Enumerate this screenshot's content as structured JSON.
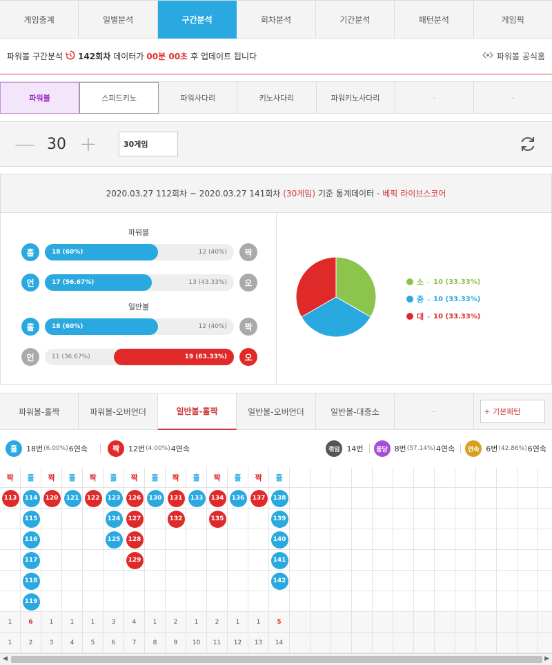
{
  "main_tabs": [
    "게임중계",
    "일별분석",
    "구간분석",
    "회차분석",
    "기간분석",
    "패턴분석",
    "게임픽"
  ],
  "main_active": 2,
  "info": {
    "prefix": "파워볼 구간분석",
    "round": "142회차",
    "mid": "데이터가",
    "time": "00분 00초",
    "suffix": "후 업데이트 됩니다",
    "official": "파워볼 공식홈"
  },
  "game_tabs": [
    "파워볼",
    "스피드키노",
    "파워사다리",
    "키노사다리",
    "파워키노사다리",
    "-",
    "-"
  ],
  "counter": {
    "value": "30",
    "select_label": "30게임"
  },
  "stats_header": {
    "period": "2020.03.27 112회차 ~ 2020.03.27 141회차",
    "games": "(30게임)",
    "mid": "기준 통계데이터 -",
    "source": "베픽 라이브스코어"
  },
  "powerball": {
    "title": "파워볼",
    "rows": [
      {
        "left_label": "홀",
        "right_label": "짝",
        "left_text": "18 (60%)",
        "right_text": "12 (40%)",
        "left_value": 0.6,
        "winner": "left"
      },
      {
        "left_label": "언",
        "right_label": "오",
        "left_text": "17 (56.67%)",
        "right_text": "13 (43.33%)",
        "left_value": 0.5667,
        "winner": "left"
      }
    ]
  },
  "normalball": {
    "title": "일반볼",
    "rows": [
      {
        "left_label": "홀",
        "right_label": "짝",
        "left_text": "18 (60%)",
        "right_text": "12 (40%)",
        "left_value": 0.6,
        "winner": "left"
      },
      {
        "left_label": "언",
        "right_label": "오",
        "left_text": "11 (36.67%)",
        "right_text": "19 (63.33%)",
        "left_value": 0.3667,
        "winner": "right"
      }
    ]
  },
  "pie": {
    "slices": [
      {
        "label": "소",
        "value": 10,
        "text": "10 (33.33%)",
        "color": "#8dc44e"
      },
      {
        "label": "중",
        "value": 10,
        "text": "10 (33.33%)",
        "color": "#29a9e0"
      },
      {
        "label": "대",
        "value": 10,
        "text": "10 (33.33%)",
        "color": "#e02a2a"
      }
    ]
  },
  "pattern_tabs": [
    "파워볼-홀짝",
    "파워볼-오버언더",
    "일반볼-홀짝",
    "일반볼-오버언더",
    "일반볼-대중소",
    "-"
  ],
  "pattern_active": 2,
  "pattern_button": "+ 기본패턴",
  "summary": {
    "odd": {
      "label": "홀",
      "count": "18번",
      "pct": "(6.00%)",
      "streak": "6연속"
    },
    "even": {
      "label": "짝",
      "count": "12번",
      "pct": "(4.00%)",
      "streak": "4연속"
    },
    "break": {
      "label": "꺾임",
      "count": "14번"
    },
    "pong": {
      "label": "퐁당",
      "count": "8번",
      "pct": "(57.14%)",
      "streak": "4연속"
    },
    "cont": {
      "label": "연속",
      "count": "6번",
      "pct": "(42.86%)",
      "streak": "6연속"
    }
  },
  "grid": {
    "columns": [
      {
        "head": "짝",
        "type": "even",
        "balls": [
          "113"
        ],
        "count": "1",
        "idx": "1"
      },
      {
        "head": "홀",
        "type": "odd",
        "balls": [
          "114",
          "115",
          "116",
          "117",
          "118",
          "119"
        ],
        "count": "6",
        "idx": "2"
      },
      {
        "head": "짝",
        "type": "even",
        "balls": [
          "120"
        ],
        "count": "1",
        "idx": "3"
      },
      {
        "head": "홀",
        "type": "odd",
        "balls": [
          "121"
        ],
        "count": "1",
        "idx": "4"
      },
      {
        "head": "짝",
        "type": "even",
        "balls": [
          "122"
        ],
        "count": "1",
        "idx": "5"
      },
      {
        "head": "홀",
        "type": "odd",
        "balls": [
          "123",
          "124",
          "125"
        ],
        "count": "3",
        "idx": "6"
      },
      {
        "head": "짝",
        "type": "even",
        "balls": [
          "126",
          "127",
          "128",
          "129"
        ],
        "count": "4",
        "idx": "7"
      },
      {
        "head": "홀",
        "type": "odd",
        "balls": [
          "130"
        ],
        "count": "1",
        "idx": "8"
      },
      {
        "head": "짝",
        "type": "even",
        "balls": [
          "131",
          "132"
        ],
        "count": "2",
        "idx": "9"
      },
      {
        "head": "홀",
        "type": "odd",
        "balls": [
          "133"
        ],
        "count": "1",
        "idx": "10"
      },
      {
        "head": "짝",
        "type": "even",
        "balls": [
          "134",
          "135"
        ],
        "count": "2",
        "idx": "11"
      },
      {
        "head": "홀",
        "type": "odd",
        "balls": [
          "136"
        ],
        "count": "1",
        "idx": "12"
      },
      {
        "head": "짝",
        "type": "even",
        "balls": [
          "137"
        ],
        "count": "1",
        "idx": "13"
      },
      {
        "head": "홀",
        "type": "odd",
        "balls": [
          "138",
          "139",
          "140",
          "141",
          "142"
        ],
        "count": "5",
        "idx": "14"
      }
    ],
    "highlight_counts": [
      "6",
      "5"
    ],
    "total_columns": 27,
    "total_rows": 6
  }
}
